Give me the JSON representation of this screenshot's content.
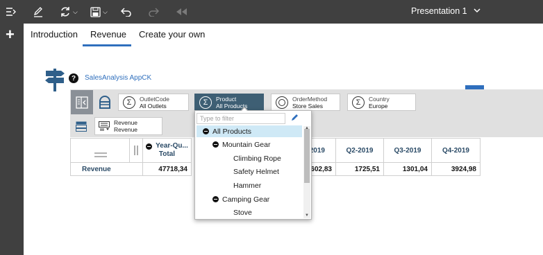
{
  "toolbar": {
    "presentation_title": "Presentation 1",
    "icons": [
      "menu-icon",
      "edit-icon",
      "refresh-icon",
      "save-icon",
      "undo-icon",
      "redo-icon",
      "rewind-icon",
      "chevron-down-icon"
    ]
  },
  "tabs": [
    {
      "label": "Introduction"
    },
    {
      "label": "Revenue"
    },
    {
      "label": "Create your own"
    }
  ],
  "header": {
    "app_name": "SalesAnalysis AppCK",
    "help_label": "?"
  },
  "filters": [
    {
      "dimension": "OutletCode",
      "value": "All Outlets"
    },
    {
      "dimension": "Product",
      "value": "All Products"
    },
    {
      "dimension": "OrderMethod",
      "value": "Store Sales"
    },
    {
      "dimension": "Country",
      "value": "Europe"
    }
  ],
  "measure": {
    "line1": "Revenue",
    "line2": "Revenue"
  },
  "table": {
    "col_dimension": "Year-Qu...",
    "col_total": "Total",
    "columns": [
      "2019",
      "Q2-2019",
      "Q3-2019",
      "Q4-2019"
    ],
    "row_label": "Revenue",
    "total_value": "47718,34",
    "values": [
      "1602,83",
      "1725,51",
      "1301,04",
      "3924,98"
    ]
  },
  "dropdown": {
    "filter_placeholder": "Type to filter",
    "items": [
      {
        "label": "All Products",
        "level": 0,
        "expanded": true,
        "selected": true
      },
      {
        "label": "Mountain Gear",
        "level": 1,
        "expanded": true,
        "selected": false
      },
      {
        "label": "Climbing Rope",
        "level": 2,
        "expanded": false,
        "selected": false
      },
      {
        "label": "Safety Helmet",
        "level": 2,
        "expanded": false,
        "selected": false
      },
      {
        "label": "Hammer",
        "level": 2,
        "expanded": false,
        "selected": false
      },
      {
        "label": "Camping Gear",
        "level": 1,
        "expanded": true,
        "selected": false
      },
      {
        "label": "Stove",
        "level": 2,
        "expanded": false,
        "selected": false
      }
    ]
  },
  "colors": {
    "topbar": "#404040",
    "accent": "#2f6fbd",
    "active_chip": "#3e5f74",
    "header_text": "#2a4a66",
    "selection": "#cfe9f6"
  }
}
